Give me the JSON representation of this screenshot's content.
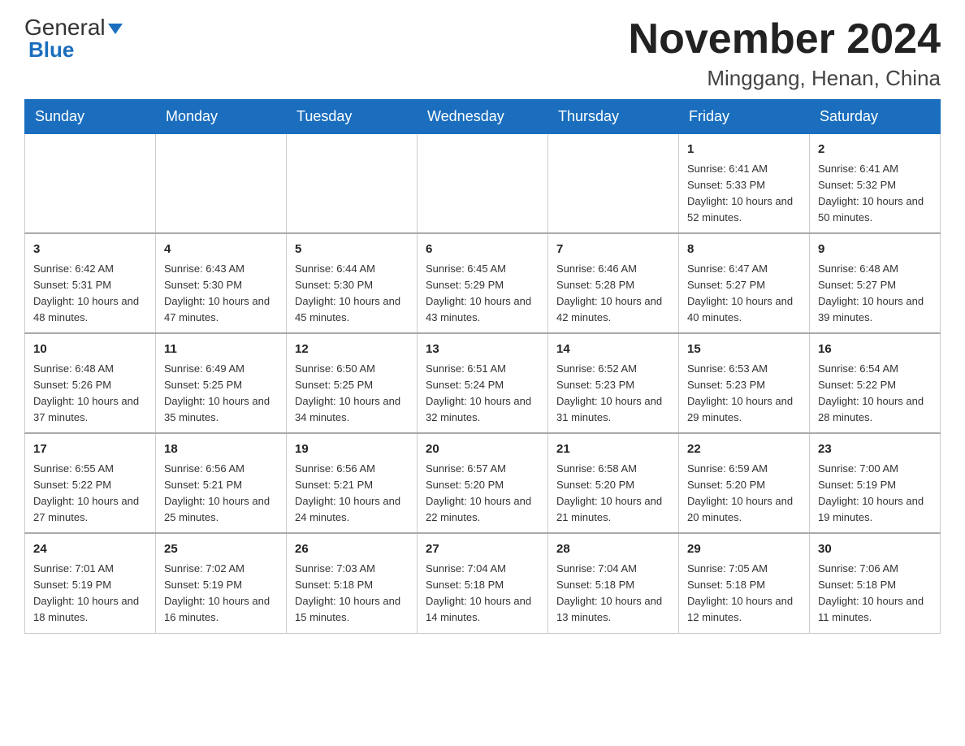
{
  "logo": {
    "general": "General",
    "triangle": "▶",
    "blue": "Blue"
  },
  "header": {
    "month_title": "November 2024",
    "location": "Minggang, Henan, China"
  },
  "weekdays": [
    "Sunday",
    "Monday",
    "Tuesday",
    "Wednesday",
    "Thursday",
    "Friday",
    "Saturday"
  ],
  "weeks": [
    [
      {
        "day": "",
        "info": ""
      },
      {
        "day": "",
        "info": ""
      },
      {
        "day": "",
        "info": ""
      },
      {
        "day": "",
        "info": ""
      },
      {
        "day": "",
        "info": ""
      },
      {
        "day": "1",
        "info": "Sunrise: 6:41 AM\nSunset: 5:33 PM\nDaylight: 10 hours and 52 minutes."
      },
      {
        "day": "2",
        "info": "Sunrise: 6:41 AM\nSunset: 5:32 PM\nDaylight: 10 hours and 50 minutes."
      }
    ],
    [
      {
        "day": "3",
        "info": "Sunrise: 6:42 AM\nSunset: 5:31 PM\nDaylight: 10 hours and 48 minutes."
      },
      {
        "day": "4",
        "info": "Sunrise: 6:43 AM\nSunset: 5:30 PM\nDaylight: 10 hours and 47 minutes."
      },
      {
        "day": "5",
        "info": "Sunrise: 6:44 AM\nSunset: 5:30 PM\nDaylight: 10 hours and 45 minutes."
      },
      {
        "day": "6",
        "info": "Sunrise: 6:45 AM\nSunset: 5:29 PM\nDaylight: 10 hours and 43 minutes."
      },
      {
        "day": "7",
        "info": "Sunrise: 6:46 AM\nSunset: 5:28 PM\nDaylight: 10 hours and 42 minutes."
      },
      {
        "day": "8",
        "info": "Sunrise: 6:47 AM\nSunset: 5:27 PM\nDaylight: 10 hours and 40 minutes."
      },
      {
        "day": "9",
        "info": "Sunrise: 6:48 AM\nSunset: 5:27 PM\nDaylight: 10 hours and 39 minutes."
      }
    ],
    [
      {
        "day": "10",
        "info": "Sunrise: 6:48 AM\nSunset: 5:26 PM\nDaylight: 10 hours and 37 minutes."
      },
      {
        "day": "11",
        "info": "Sunrise: 6:49 AM\nSunset: 5:25 PM\nDaylight: 10 hours and 35 minutes."
      },
      {
        "day": "12",
        "info": "Sunrise: 6:50 AM\nSunset: 5:25 PM\nDaylight: 10 hours and 34 minutes."
      },
      {
        "day": "13",
        "info": "Sunrise: 6:51 AM\nSunset: 5:24 PM\nDaylight: 10 hours and 32 minutes."
      },
      {
        "day": "14",
        "info": "Sunrise: 6:52 AM\nSunset: 5:23 PM\nDaylight: 10 hours and 31 minutes."
      },
      {
        "day": "15",
        "info": "Sunrise: 6:53 AM\nSunset: 5:23 PM\nDaylight: 10 hours and 29 minutes."
      },
      {
        "day": "16",
        "info": "Sunrise: 6:54 AM\nSunset: 5:22 PM\nDaylight: 10 hours and 28 minutes."
      }
    ],
    [
      {
        "day": "17",
        "info": "Sunrise: 6:55 AM\nSunset: 5:22 PM\nDaylight: 10 hours and 27 minutes."
      },
      {
        "day": "18",
        "info": "Sunrise: 6:56 AM\nSunset: 5:21 PM\nDaylight: 10 hours and 25 minutes."
      },
      {
        "day": "19",
        "info": "Sunrise: 6:56 AM\nSunset: 5:21 PM\nDaylight: 10 hours and 24 minutes."
      },
      {
        "day": "20",
        "info": "Sunrise: 6:57 AM\nSunset: 5:20 PM\nDaylight: 10 hours and 22 minutes."
      },
      {
        "day": "21",
        "info": "Sunrise: 6:58 AM\nSunset: 5:20 PM\nDaylight: 10 hours and 21 minutes."
      },
      {
        "day": "22",
        "info": "Sunrise: 6:59 AM\nSunset: 5:20 PM\nDaylight: 10 hours and 20 minutes."
      },
      {
        "day": "23",
        "info": "Sunrise: 7:00 AM\nSunset: 5:19 PM\nDaylight: 10 hours and 19 minutes."
      }
    ],
    [
      {
        "day": "24",
        "info": "Sunrise: 7:01 AM\nSunset: 5:19 PM\nDaylight: 10 hours and 18 minutes."
      },
      {
        "day": "25",
        "info": "Sunrise: 7:02 AM\nSunset: 5:19 PM\nDaylight: 10 hours and 16 minutes."
      },
      {
        "day": "26",
        "info": "Sunrise: 7:03 AM\nSunset: 5:18 PM\nDaylight: 10 hours and 15 minutes."
      },
      {
        "day": "27",
        "info": "Sunrise: 7:04 AM\nSunset: 5:18 PM\nDaylight: 10 hours and 14 minutes."
      },
      {
        "day": "28",
        "info": "Sunrise: 7:04 AM\nSunset: 5:18 PM\nDaylight: 10 hours and 13 minutes."
      },
      {
        "day": "29",
        "info": "Sunrise: 7:05 AM\nSunset: 5:18 PM\nDaylight: 10 hours and 12 minutes."
      },
      {
        "day": "30",
        "info": "Sunrise: 7:06 AM\nSunset: 5:18 PM\nDaylight: 10 hours and 11 minutes."
      }
    ]
  ]
}
